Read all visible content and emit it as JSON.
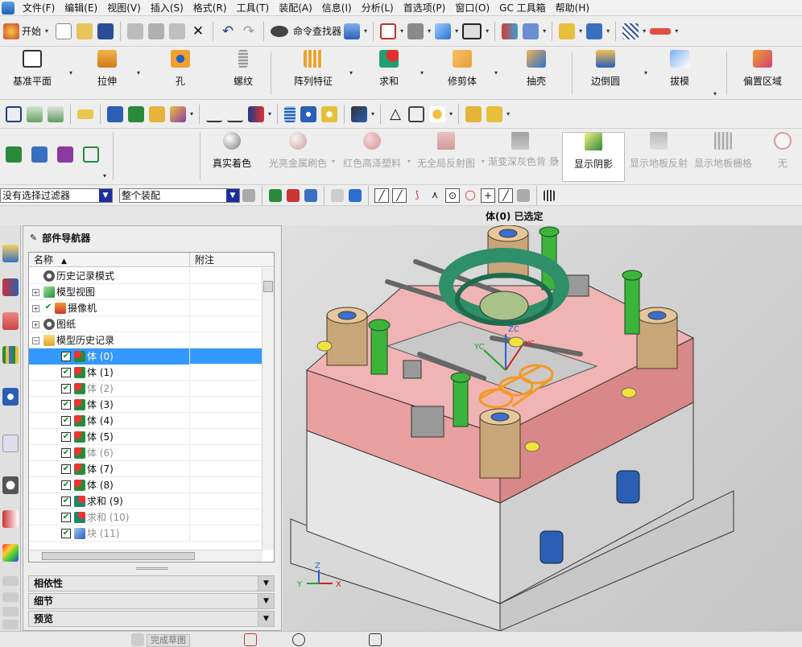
{
  "menu": [
    "文件(F)",
    "编辑(E)",
    "视图(V)",
    "插入(S)",
    "格式(R)",
    "工具(T)",
    "装配(A)",
    "信息(I)",
    "分析(L)",
    "首选项(P)",
    "窗口(O)",
    "GC 工具箱",
    "帮助(H)"
  ],
  "toolbar1": {
    "start_label": "开始",
    "command_finder": "命令查找器"
  },
  "feature_toolbar": [
    "基准平面",
    "拉伸",
    "孔",
    "螺纹",
    "阵列特征",
    "求和",
    "修剪体",
    "抽壳",
    "边倒圆",
    "拔模",
    "偏置区域"
  ],
  "shading_toolbar": [
    {
      "label": "真实着色",
      "state": "normal"
    },
    {
      "label": "光亮金属刷色",
      "state": "dim"
    },
    {
      "label": "红色高泽塑料",
      "state": "dim"
    },
    {
      "label": "无全局反射图",
      "state": "dim"
    },
    {
      "label": "渐变深灰色背",
      "label2": "景",
      "state": "dim"
    },
    {
      "label": "显示阴影",
      "state": "active"
    },
    {
      "label": "显示地板反射",
      "state": "dim"
    },
    {
      "label": "显示地板栅格",
      "state": "dim"
    },
    {
      "label": "无",
      "state": "dim"
    }
  ],
  "selection": {
    "filter": "没有选择过滤器",
    "scope": "整个装配"
  },
  "status_message": "体(0) 已选定",
  "navigator": {
    "title": "部件导航器",
    "col_name": "名称",
    "col_note": "附注",
    "rows": [
      {
        "label": "历史记录模式",
        "indent": 1,
        "exp": "",
        "chk": false,
        "icon": "clock",
        "dim": false
      },
      {
        "label": "模型视图",
        "indent": 1,
        "exp": "+",
        "chk": false,
        "icon": "cube",
        "dim": false
      },
      {
        "label": "摄像机",
        "indent": 1,
        "exp": "+",
        "chk": true,
        "icon": "camera",
        "dim": false
      },
      {
        "label": "图纸",
        "indent": 1,
        "exp": "+",
        "chk": false,
        "icon": "clock",
        "dim": false
      },
      {
        "label": "模型历史记录",
        "indent": 1,
        "exp": "−",
        "chk": false,
        "icon": "folder",
        "dim": false
      },
      {
        "label": "体 (0)",
        "indent": 2,
        "chk": true,
        "icon": "body",
        "dim": false,
        "selected": true
      },
      {
        "label": "体 (1)",
        "indent": 2,
        "chk": true,
        "icon": "body",
        "dim": false
      },
      {
        "label": "体 (2)",
        "indent": 2,
        "chk": true,
        "icon": "body",
        "dim": true
      },
      {
        "label": "体 (3)",
        "indent": 2,
        "chk": true,
        "icon": "body",
        "dim": false
      },
      {
        "label": "体 (4)",
        "indent": 2,
        "chk": true,
        "icon": "body",
        "dim": false
      },
      {
        "label": "体 (5)",
        "indent": 2,
        "chk": true,
        "icon": "body",
        "dim": false
      },
      {
        "label": "体 (6)",
        "indent": 2,
        "chk": true,
        "icon": "body",
        "dim": true
      },
      {
        "label": "体 (7)",
        "indent": 2,
        "chk": true,
        "icon": "body",
        "dim": false
      },
      {
        "label": "体 (8)",
        "indent": 2,
        "chk": true,
        "icon": "body",
        "dim": false
      },
      {
        "label": "求和 (9)",
        "indent": 2,
        "chk": true,
        "icon": "unite",
        "dim": false
      },
      {
        "label": "求和 (10)",
        "indent": 2,
        "chk": true,
        "icon": "unite",
        "dim": true
      },
      {
        "label": "块 (11)",
        "indent": 2,
        "chk": true,
        "icon": "block",
        "dim": true
      }
    ]
  },
  "sections": [
    "相依性",
    "细节",
    "预览"
  ],
  "viewport": {
    "axis_zc": "ZC",
    "axis_yc": "YC",
    "axis_xc": "XC",
    "triad_x": "X",
    "triad_y": "Y",
    "triad_z": "Z"
  },
  "bottom": {
    "sketch_label": "完成草图"
  },
  "colors": {
    "selected_row": "#3399ff",
    "mold_pink": "#e8a0a0",
    "cylinder_tan": "#c9a57a",
    "bolt_green": "#3cb43c",
    "ring_teal": "#2e8f6a"
  }
}
